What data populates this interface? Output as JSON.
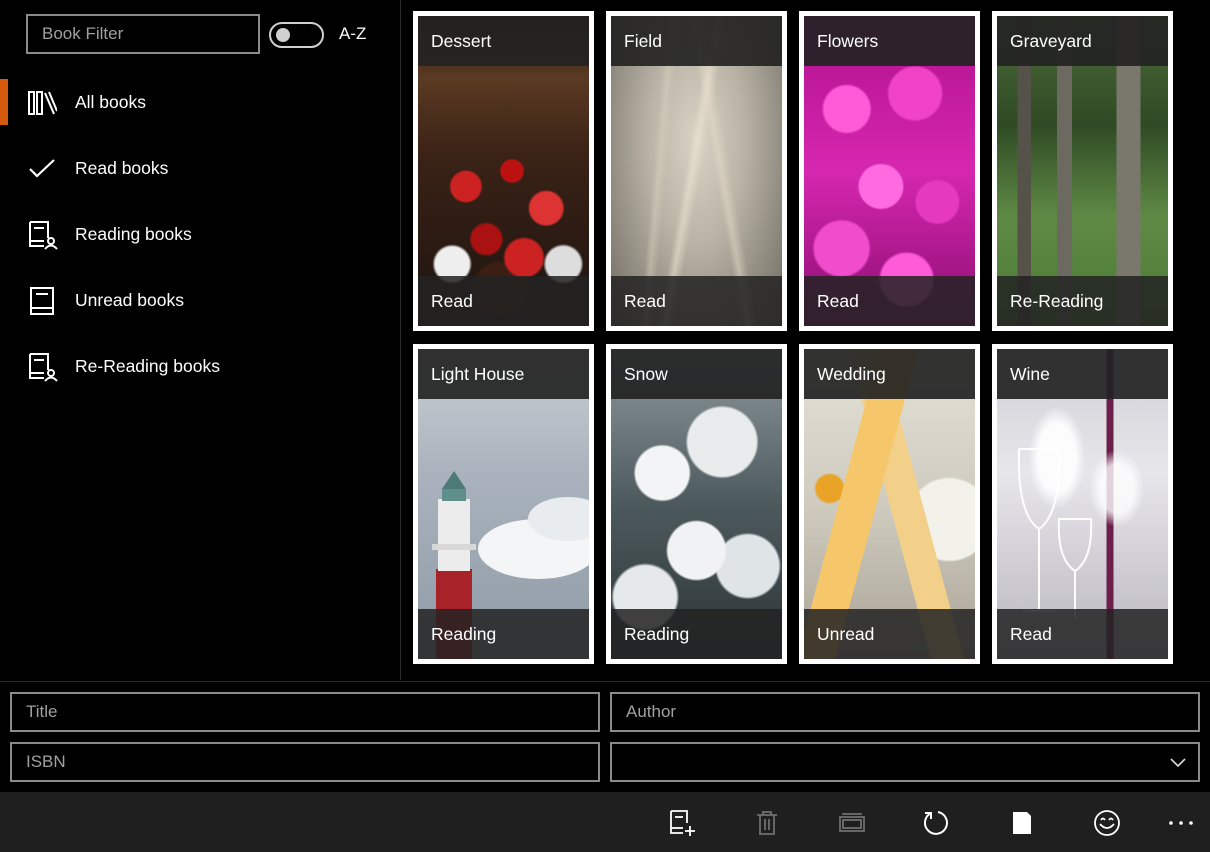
{
  "filter": {
    "placeholder": "Book Filter"
  },
  "sort_toggle": {
    "label": "A-Z",
    "on": false
  },
  "nav": {
    "items": [
      {
        "label": "All books",
        "icon": "library-icon",
        "selected": true
      },
      {
        "label": "Read books",
        "icon": "checkmark-icon",
        "selected": false
      },
      {
        "label": "Reading books",
        "icon": "reading-book-icon",
        "selected": false
      },
      {
        "label": "Unread books",
        "icon": "book-icon",
        "selected": false
      },
      {
        "label": "Re-Reading books",
        "icon": "reading-book-icon",
        "selected": false
      }
    ]
  },
  "books": [
    {
      "title": "Dessert",
      "status": "Read"
    },
    {
      "title": "Field",
      "status": "Read"
    },
    {
      "title": "Flowers",
      "status": "Read"
    },
    {
      "title": "Graveyard",
      "status": "Re-Reading"
    },
    {
      "title": "Light House",
      "status": "Reading"
    },
    {
      "title": "Snow",
      "status": "Reading"
    },
    {
      "title": "Wedding",
      "status": "Unread"
    },
    {
      "title": "Wine",
      "status": "Read"
    }
  ],
  "form": {
    "title_placeholder": "Title",
    "author_placeholder": "Author",
    "isbn_placeholder": "ISBN",
    "status_value": ""
  },
  "toolbar": {
    "buttons": [
      "add-book-icon",
      "delete-icon",
      "gallery-icon",
      "refresh-icon",
      "page-icon",
      "emoji-icon",
      "more-icon"
    ]
  },
  "colors": {
    "accent": "#d65a0e",
    "background": "#000000",
    "command_bar": "#1f1f1f",
    "tile_border": "#ffffff"
  }
}
